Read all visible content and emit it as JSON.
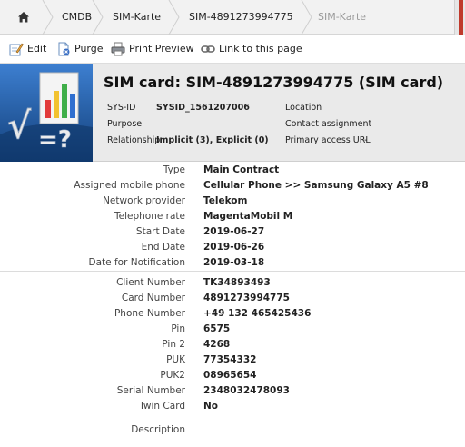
{
  "breadcrumb": {
    "items": [
      "CMDB",
      "SIM-Karte",
      "SIM-4891273994775",
      "SIM-Karte"
    ]
  },
  "toolbar": {
    "edit": "Edit",
    "purge": "Purge",
    "print_preview": "Print Preview",
    "link": "Link to this page"
  },
  "header": {
    "title": "SIM card: SIM-4891273994775 (SIM card)",
    "sysid_label": "SYS-ID",
    "sysid_value": "SYSID_1561207006",
    "purpose_label": "Purpose",
    "relationship_label": "Relationship",
    "relationship_value": "Implicit (3), Explicit (0)",
    "location_label": "Location",
    "contact_label": "Contact assignment",
    "primary_url_label": "Primary access URL",
    "primary_url_value": "-"
  },
  "details_top": [
    {
      "label": "Type",
      "value": "Main Contract"
    },
    {
      "label": "Assigned mobile phone",
      "value": "Cellular Phone >> Samsung Galaxy A5 #8"
    },
    {
      "label": "Network provider",
      "value": "Telekom"
    },
    {
      "label": "Telephone rate",
      "value": "MagentaMobil M"
    },
    {
      "label": "Start Date",
      "value": "2019-06-27"
    },
    {
      "label": "End Date",
      "value": "2019-06-26"
    },
    {
      "label": "Date for Notification",
      "value": "2019-03-18"
    }
  ],
  "details_bottom": [
    {
      "label": "Client Number",
      "value": "TK34893493"
    },
    {
      "label": "Card Number",
      "value": "4891273994775"
    },
    {
      "label": "Phone Number",
      "value": "+49 132 465425436"
    },
    {
      "label": "Pin",
      "value": "6575"
    },
    {
      "label": "Pin 2",
      "value": "4268"
    },
    {
      "label": "PUK",
      "value": "77354332"
    },
    {
      "label": "PUK2",
      "value": "08965654"
    },
    {
      "label": "Serial Number",
      "value": "2348032478093"
    },
    {
      "label": "Twin Card",
      "value": "No"
    }
  ],
  "description_label": "Description",
  "colors": {
    "breadcrumb_bg": "#f2f2f2",
    "header_bg": "#eaeaea",
    "accent_red": "#c0392b",
    "logo_blue": "#1f5fa8"
  }
}
